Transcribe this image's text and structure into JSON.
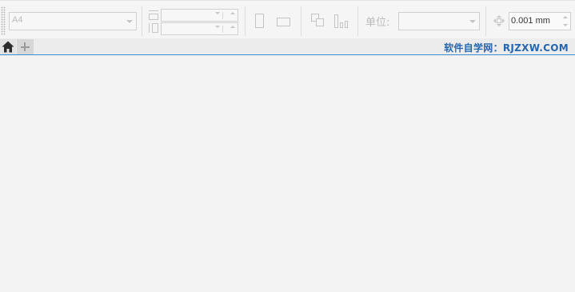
{
  "toolbar": {
    "page_size": {
      "value": "A4"
    },
    "page_width": {
      "value": ""
    },
    "page_height": {
      "value": ""
    },
    "units_label": "单位:",
    "units": {
      "value": ""
    },
    "nudge": {
      "value": "0.001 mm"
    }
  },
  "tabs": {
    "home_icon": "home-icon",
    "add_icon": "plus-icon"
  },
  "watermark": "软件自学网：RJZXW.COM",
  "colors": {
    "accent": "#3a8bd0",
    "watermark": "#2466b0",
    "background": "#f3f3f3"
  }
}
